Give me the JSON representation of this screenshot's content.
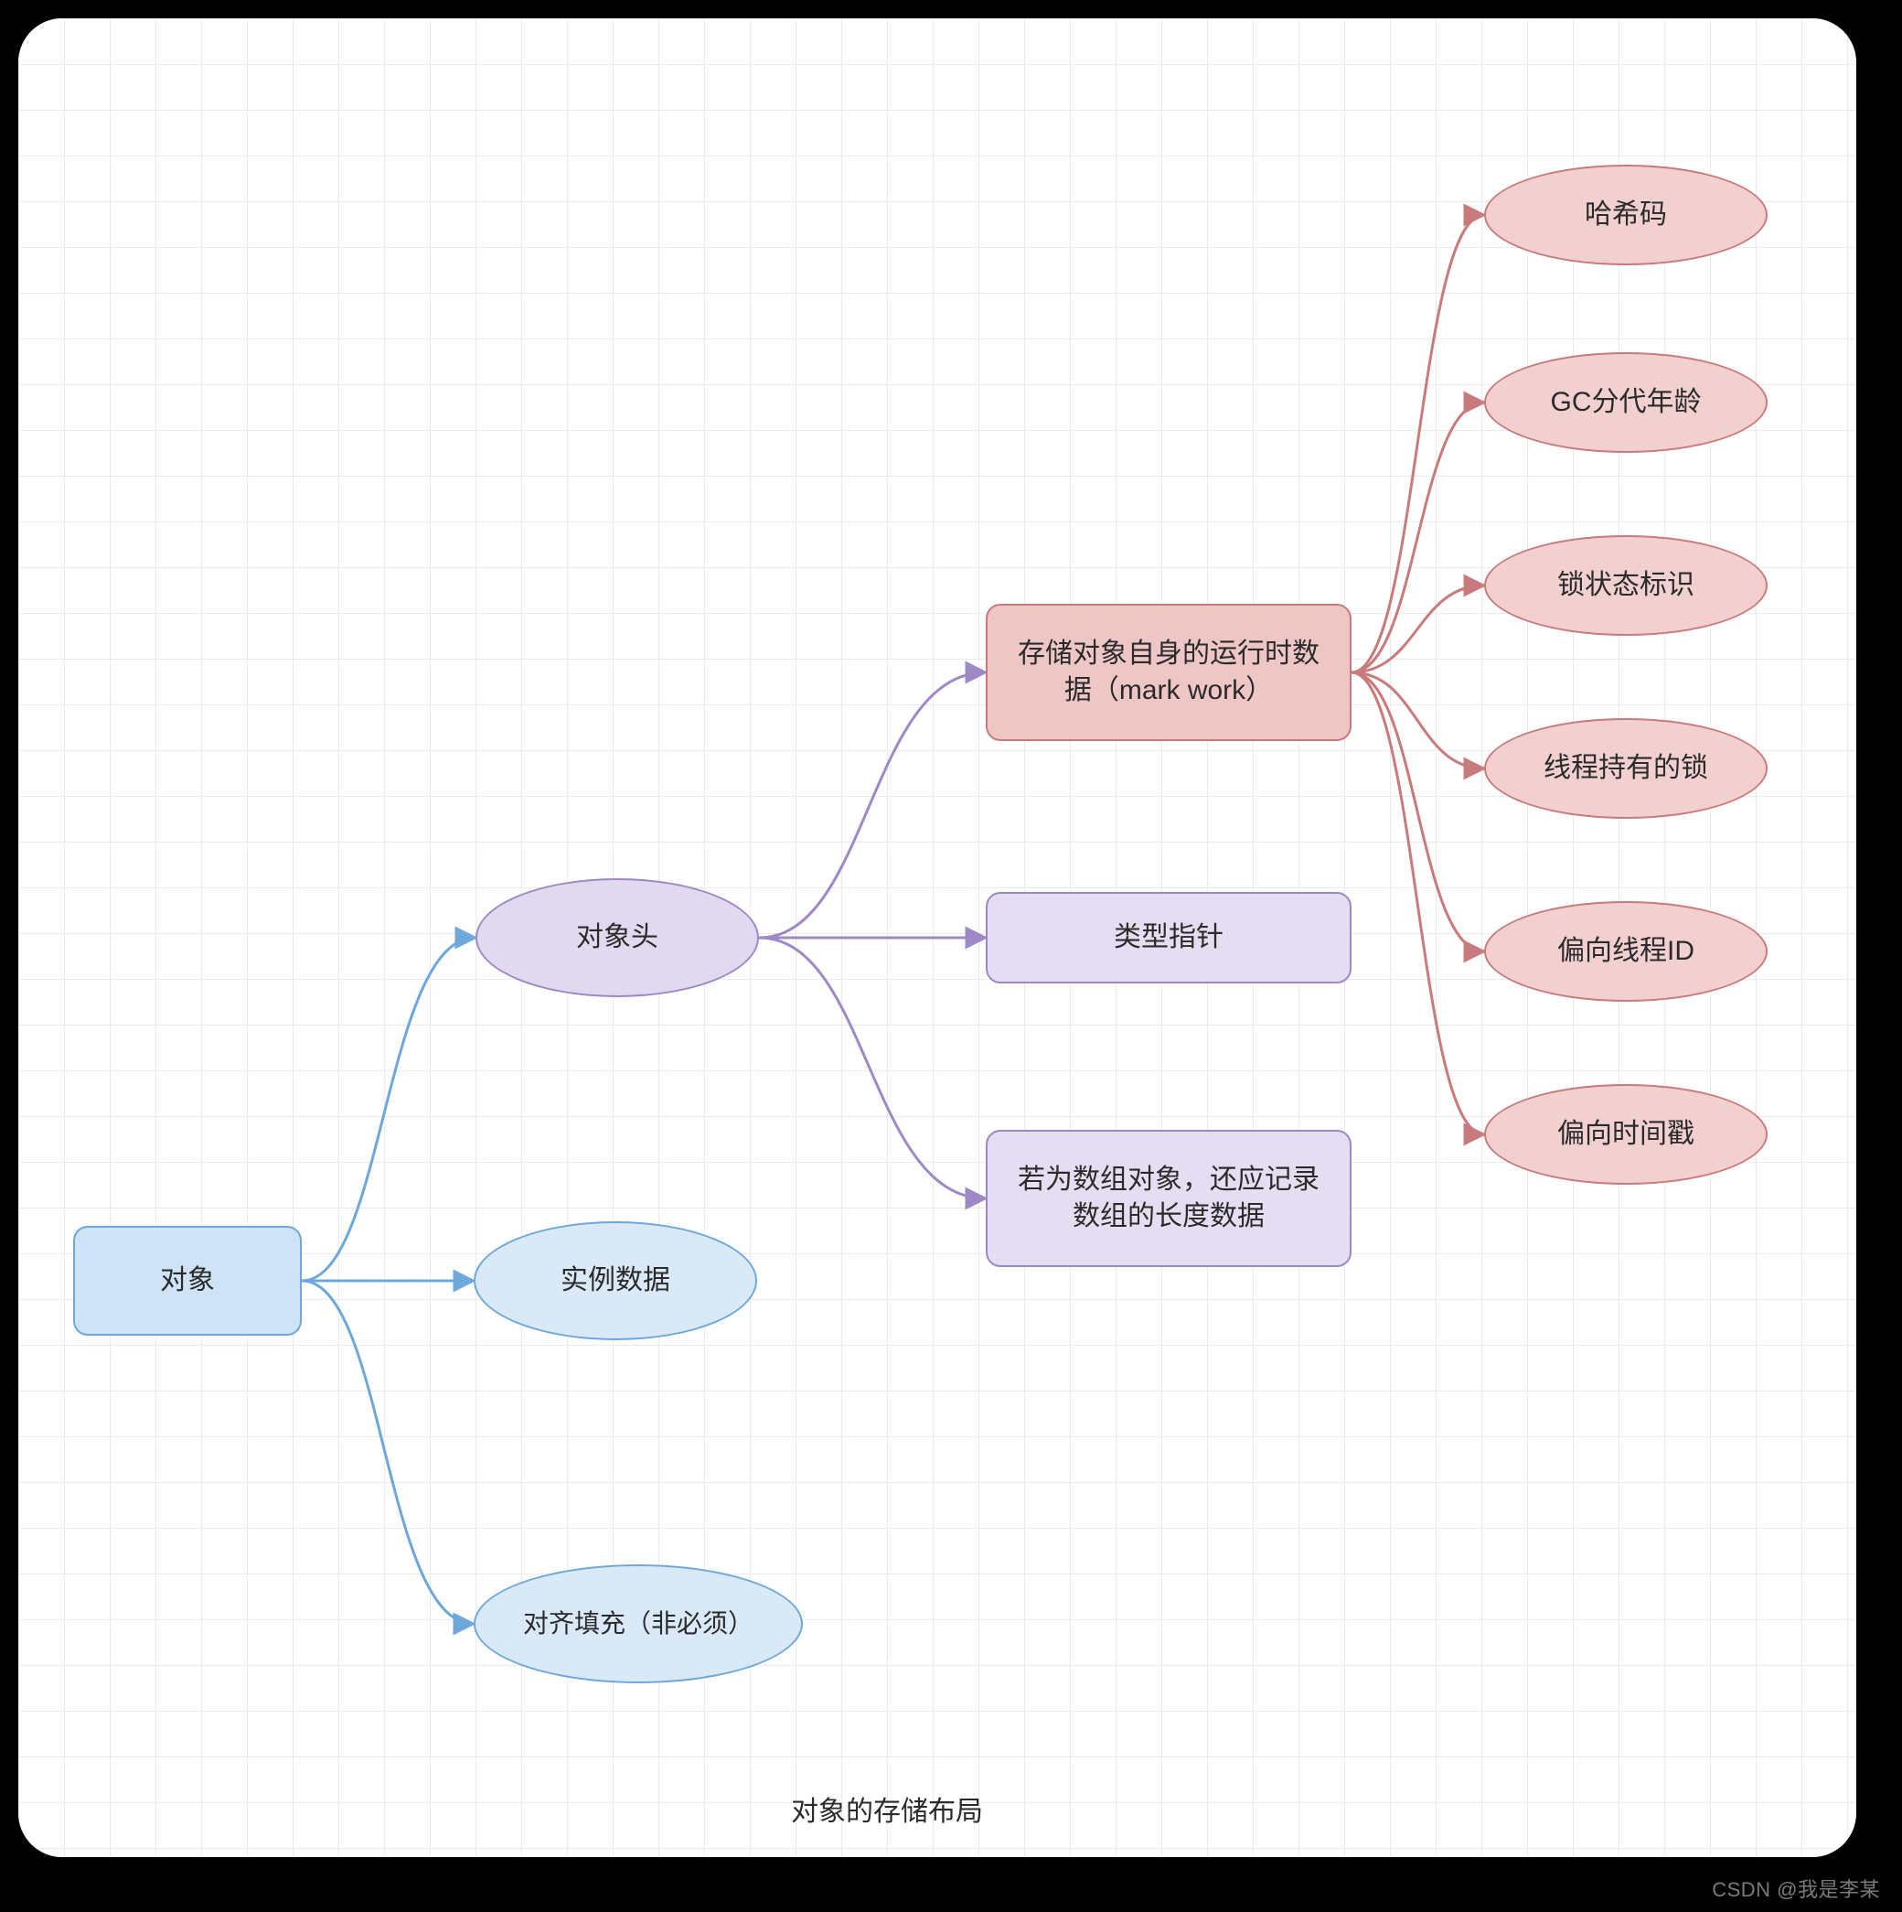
{
  "caption": "对象的存储布局",
  "watermark": "CSDN @我是李某",
  "nodes": {
    "root": "对象",
    "header": "对象头",
    "instance": "实例数据",
    "padding": "对齐填充（非必须）",
    "markword": "存储对象自身的运行时数据（mark work）",
    "klass": "类型指针",
    "arraylen": "若为数组对象，还应记录数组的长度数据",
    "hash": "哈希码",
    "age": "GC分代年龄",
    "lockflag": "锁状态标识",
    "heldlock": "线程持有的锁",
    "biasid": "偏向线程ID",
    "biastime": "偏向时间戳"
  },
  "colors": {
    "blue_stroke": "#6ea7dc",
    "purple_stroke": "#9e88c6",
    "pink_stroke": "#c97a7a"
  }
}
